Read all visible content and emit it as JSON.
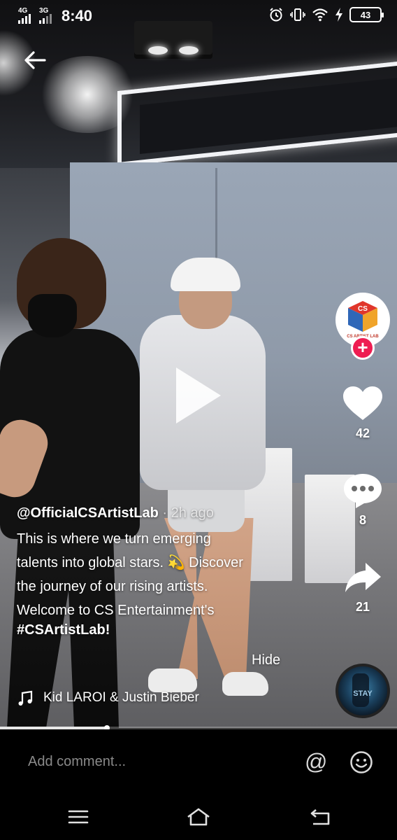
{
  "status_bar": {
    "network_1": "4G",
    "network_2": "3G",
    "time": "8:40",
    "battery": "43",
    "icons": [
      "alarm-icon",
      "vibrate-icon",
      "wifi-icon",
      "charging-icon",
      "battery-icon"
    ]
  },
  "video": {
    "playing": false
  },
  "profile": {
    "avatar_text": "CS ARTIST LAB",
    "follow_label": "+"
  },
  "actions": {
    "likes": "42",
    "comments": "8",
    "shares": "21"
  },
  "caption": {
    "username": "@OfficialCSArtistLab",
    "posted": " · 2h ago",
    "description": "This is where we turn emerging\ntalents into global stars. 💫 Discover\nthe journey of our rising artists.\nWelcome to CS Entertainment's",
    "hashtag": "#CSArtistLab!",
    "hide_label": "Hide"
  },
  "music": {
    "title": "Kid LAROI & Justin Bieber"
  },
  "progress": {
    "fraction": 0.27
  },
  "comment": {
    "placeholder": "Add comment..."
  },
  "colors": {
    "accent": "#ee1d52",
    "logo_red": "#e0362b",
    "logo_blue": "#2f67b8",
    "logo_orange": "#f0a42a"
  }
}
